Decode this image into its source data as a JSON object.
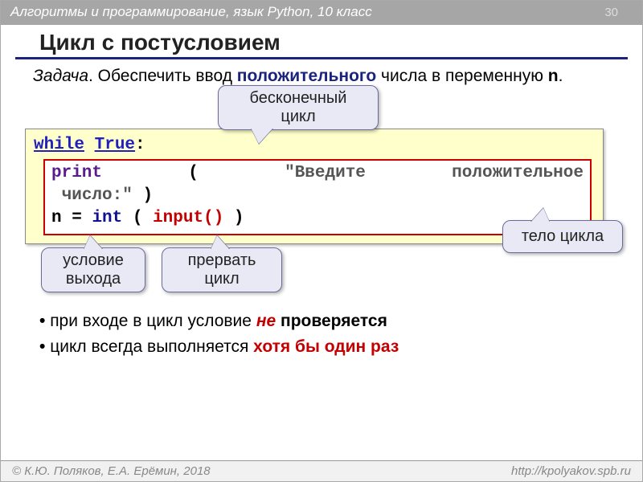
{
  "header": {
    "course": "Алгоритмы и программирование, язык Python, 10 класс",
    "page": "30"
  },
  "title": "Цикл с постусловием",
  "task": {
    "label": "Задача",
    "before_kw": ". Обеспечить ввод ",
    "keyword": "положительного",
    "after_kw": " числа в переменную ",
    "var": "n",
    "end": "."
  },
  "code": {
    "line1": {
      "while": "while",
      "true": "True",
      "colon": ":"
    },
    "line2": {
      "print": "print",
      "open": "(",
      "str1": "\"Введите",
      "str2": "положительное",
      "str3": "число:\"",
      "close": ")"
    },
    "line3": {
      "n": "n",
      "eq": "=",
      "int": "int",
      "open": "(",
      "input": "input()",
      "close": ")"
    }
  },
  "callouts": {
    "infinite": "бесконечный цикл",
    "body": "тело цикла",
    "exit": "условие выхода",
    "break": "прервать цикл"
  },
  "bullets": {
    "b1_a": "при входе в цикл условие ",
    "b1_em": "не",
    "b1_b": " проверяется",
    "b2_a": "цикл всегда выполняется ",
    "b2_em": "хотя бы один раз"
  },
  "footer": {
    "left": "© К.Ю. Поляков, Е.А. Ерёмин, 2018",
    "right": "http://kpolyakov.spb.ru"
  }
}
